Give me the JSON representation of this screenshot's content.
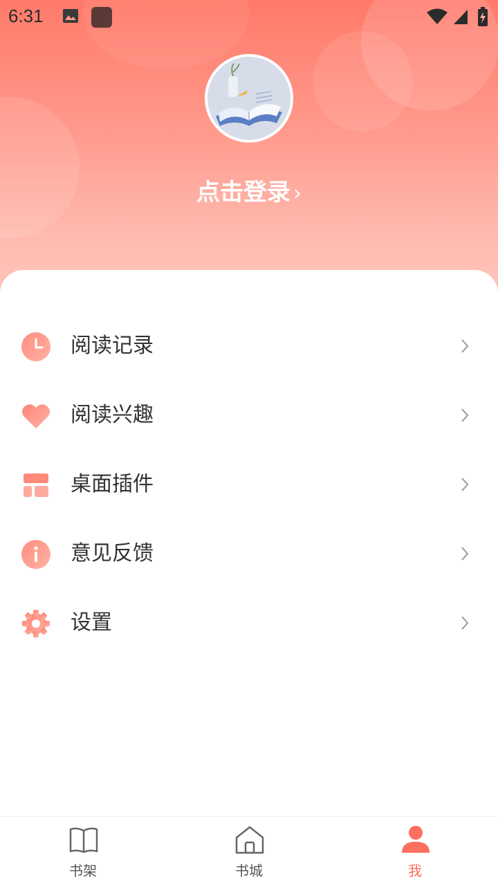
{
  "status_bar": {
    "time": "6:31"
  },
  "profile": {
    "login_text": "点击登录",
    "login_chevron": "›"
  },
  "menu": [
    {
      "label": "阅读记录",
      "icon": "clock-icon"
    },
    {
      "label": "阅读兴趣",
      "icon": "heart-icon"
    },
    {
      "label": "桌面插件",
      "icon": "widget-icon"
    },
    {
      "label": "意见反馈",
      "icon": "info-icon"
    },
    {
      "label": "设置",
      "icon": "gear-icon"
    }
  ],
  "bottom_nav": [
    {
      "label": "书架",
      "icon": "book-open-icon",
      "active": false
    },
    {
      "label": "书城",
      "icon": "home-icon",
      "active": false
    },
    {
      "label": "我",
      "icon": "person-icon",
      "active": true
    }
  ],
  "colors": {
    "accent": "#ff6f5e",
    "header_top": "#ff7a6a",
    "header_bottom": "#ffc4ba"
  }
}
